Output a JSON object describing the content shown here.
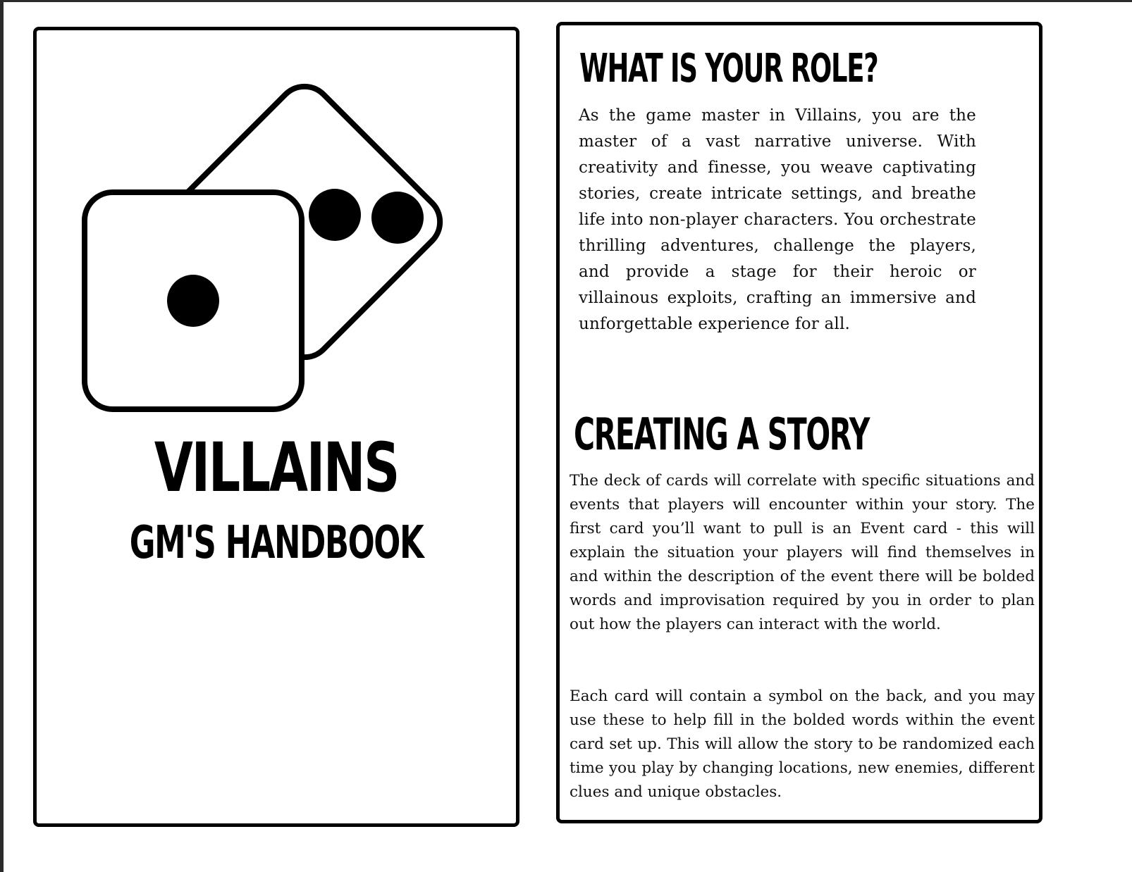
{
  "cover": {
    "title": "VILLAINS",
    "subtitle": "GM'S HANDBOOK",
    "logo_icon": "dice-icon"
  },
  "role_section": {
    "heading": "WHAT IS YOUR ROLE?",
    "body": "As the game master in Villains, you are the master of a vast narrative universe. With creativity and finesse, you weave captivating stories, create intricate settings, and breathe life into non-player characters. You orchestrate thrilling adventures, challenge the players, and provide a stage for their heroic or villainous exploits, crafting an immersive and unforgettable experience for all."
  },
  "story_section": {
    "heading": "CREATING A STORY",
    "paragraph_1": "The deck of cards will correlate with specific situations and events that players will encounter within your story. The first card you’ll want to pull is an Event card - this will explain the situation your players will find themselves in and within the description of the event there will be bolded words and improvisation required by you in order to plan out how the players can interact with the world.",
    "paragraph_2": "Each card will contain a symbol on the back, and you may use these to help fill in the bolded words within the event card set up. This will allow the story to be randomized each time you play by changing locations, new enemies, different clues and unique obstacles."
  }
}
